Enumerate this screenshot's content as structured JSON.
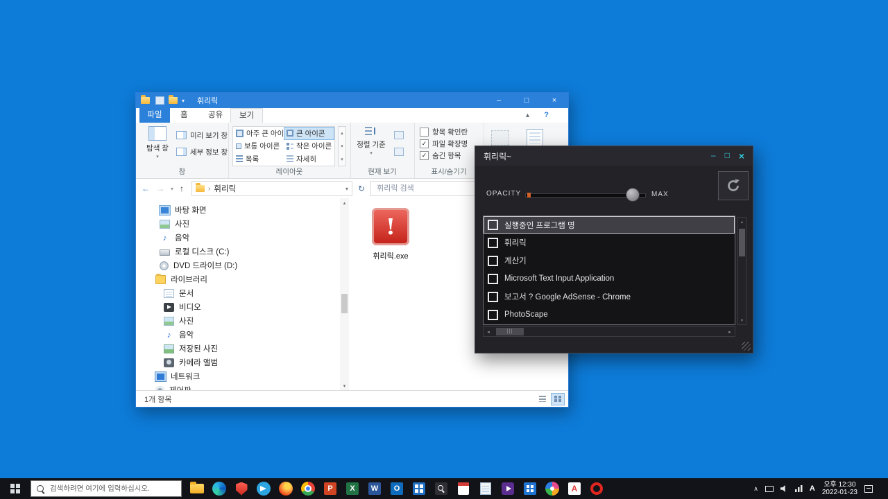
{
  "glyphs": {
    "minimize": "–",
    "maximize": "□",
    "close": "×",
    "back": "←",
    "forward": "→",
    "up": "↑",
    "refresh": "↻",
    "dropdown": "▾",
    "breadcrumb_sep": "›",
    "collapse": "▴",
    "help": "?",
    "scroll_up": "▴",
    "scroll_down": "▾",
    "scroll_left": "◂",
    "scroll_right": "▸",
    "check": "✓",
    "music": "♪",
    "exclaim": "!",
    "grip": "|||",
    "tray_chevron": "∧"
  },
  "explorer": {
    "title": "휘리릭",
    "tabs": {
      "file": "파일",
      "home": "홈",
      "share": "공유",
      "view": "보기"
    },
    "ribbon": {
      "pane_group": {
        "label": "창",
        "nav_pane": "탐색 창",
        "preview_pane": "미리 보기 창",
        "details_pane": "세부 정보 창"
      },
      "layout_group": {
        "label": "레이아웃",
        "options": [
          "아주 큰 아이콘",
          "큰 아이콘",
          "보통 아이콘",
          "작은 아이콘",
          "목록",
          "자세히"
        ],
        "selected": "큰 아이콘"
      },
      "view_group": {
        "label": "현재 보기",
        "sort_by": "정렬 기준"
      },
      "showhide_group": {
        "label": "표시/숨기기",
        "checkboxes": [
          {
            "label": "항목 확인란",
            "mark": ""
          },
          {
            "label": "파일 확장명",
            "mark": "✓"
          },
          {
            "label": "숨긴 항목",
            "mark": "✓"
          }
        ]
      }
    },
    "addressbar": {
      "breadcrumb": "휘리릭",
      "search_placeholder": "휘리릭 검색"
    },
    "nav_items": [
      {
        "label": "바탕 화면",
        "icon": "desktop-icon"
      },
      {
        "label": "사진",
        "icon": "pictures-icon"
      },
      {
        "label": "음악",
        "icon": "music-icon"
      },
      {
        "label": "로컬 디스크 (C:)",
        "icon": "local-disk-icon"
      },
      {
        "label": "DVD 드라이브 (D:)",
        "icon": "dvd-drive-icon"
      },
      {
        "label": "라이브러리",
        "icon": "libraries-icon"
      },
      {
        "label": "문서",
        "icon": "documents-icon"
      },
      {
        "label": "비디오",
        "icon": "videos-icon"
      },
      {
        "label": "사진",
        "icon": "pictures-icon"
      },
      {
        "label": "음악",
        "icon": "music-icon"
      },
      {
        "label": "저장된 사진",
        "icon": "saved-pictures-icon"
      },
      {
        "label": "카메라 앨범",
        "icon": "camera-roll-icon"
      },
      {
        "label": "네트워크",
        "icon": "network-icon"
      },
      {
        "label": "제어판",
        "icon": "control-panel-icon"
      }
    ],
    "content": {
      "file_name": "휘리릭.exe"
    },
    "status": {
      "count": "1개 항목"
    }
  },
  "app": {
    "title": "휘리릭~",
    "opacity_label": "OPACITY",
    "max_label": "MAX",
    "opacity_value_percent": 90,
    "list_header": "실행중인 프로그램 명",
    "processes": [
      "휘리릭",
      "계산기",
      "Microsoft Text Input Application",
      "보고서 ? Google AdSense - Chrome",
      "PhotoScape"
    ]
  },
  "taskbar": {
    "search_placeholder": "검색하려면 여기에 입력하십시오.",
    "apps": [
      {
        "name": "file-explorer"
      },
      {
        "name": "edge-browser"
      },
      {
        "name": "security-shield-app"
      },
      {
        "name": "telegram"
      },
      {
        "name": "firefox"
      },
      {
        "name": "chrome"
      },
      {
        "name": "powerpoint",
        "letter": "P"
      },
      {
        "name": "excel",
        "letter": "X"
      },
      {
        "name": "word",
        "letter": "W"
      },
      {
        "name": "outlook",
        "letter": "O"
      },
      {
        "name": "blue-grid-app"
      },
      {
        "name": "magnifier-app"
      },
      {
        "name": "red-document-app"
      },
      {
        "name": "notepad-app"
      },
      {
        "name": "media-player-app"
      },
      {
        "name": "calculator-app"
      },
      {
        "name": "photoscape-app"
      },
      {
        "name": "antivirus-app",
        "letter": "A"
      },
      {
        "name": "opera-browser"
      }
    ],
    "tray": {
      "time": "오후 12:30",
      "date": "2022-01-23",
      "ime": "A"
    }
  }
}
